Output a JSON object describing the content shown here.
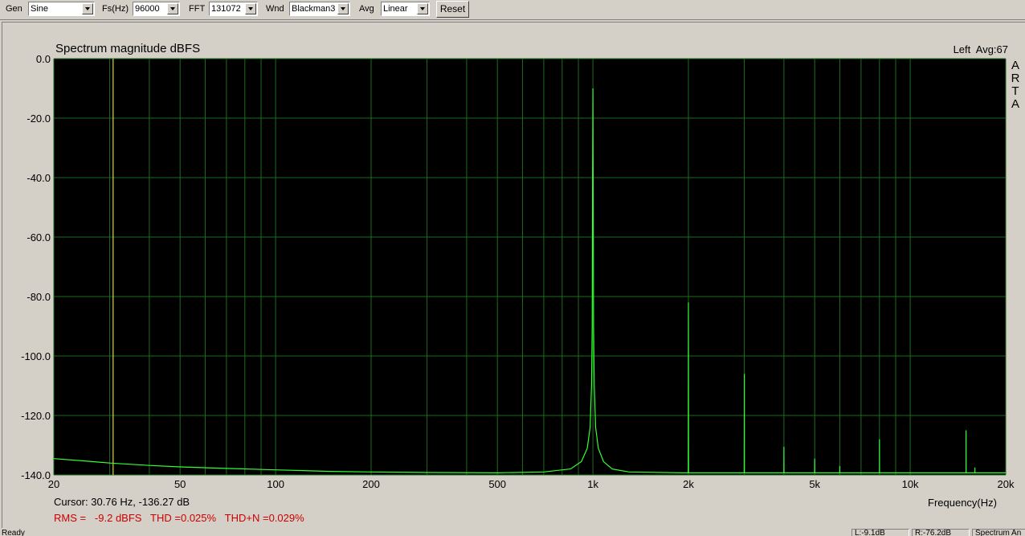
{
  "toolbar": {
    "gen": {
      "label": "Gen",
      "value": "Sine"
    },
    "fs": {
      "label": "Fs(Hz)",
      "value": "96000"
    },
    "fft": {
      "label": "FFT",
      "value": "131072"
    },
    "wnd": {
      "label": "Wnd",
      "value": "Blackman3"
    },
    "avg": {
      "label": "Avg",
      "value": "Linear"
    },
    "reset_label": "Reset"
  },
  "plot": {
    "title": "Spectrum magnitude dBFS",
    "channel_info": "Left  Avg:67",
    "side_logo": [
      "A",
      "R",
      "T",
      "A"
    ],
    "cursor": "Cursor: 30.76 Hz, -136.27 dB",
    "measurements": "RMS =   -9.2 dBFS   THD =0.025%   THD+N =0.029%",
    "x_axis_label": "Frequency(Hz)"
  },
  "chart_data": {
    "type": "line",
    "xscale": "log",
    "xlim": [
      20,
      20000
    ],
    "ylim": [
      -140,
      0
    ],
    "x_tick_labels": [
      {
        "v": 20,
        "t": "20"
      },
      {
        "v": 50,
        "t": "50"
      },
      {
        "v": 100,
        "t": "100"
      },
      {
        "v": 200,
        "t": "200"
      },
      {
        "v": 500,
        "t": "500"
      },
      {
        "v": 1000,
        "t": "1k"
      },
      {
        "v": 2000,
        "t": "2k"
      },
      {
        "v": 5000,
        "t": "5k"
      },
      {
        "v": 10000,
        "t": "10k"
      },
      {
        "v": 20000,
        "t": "20k"
      }
    ],
    "y_tick_labels": [
      {
        "v": 0,
        "t": "0.0"
      },
      {
        "v": -20,
        "t": "-20.0"
      },
      {
        "v": -40,
        "t": "-40.0"
      },
      {
        "v": -60,
        "t": "-60.0"
      },
      {
        "v": -80,
        "t": "-80.0"
      },
      {
        "v": -100,
        "t": "-100.0"
      },
      {
        "v": -120,
        "t": "-120.0"
      },
      {
        "v": -140,
        "t": "-140.0"
      }
    ],
    "grid": true,
    "cursor_x": 30.76,
    "series": [
      {
        "points": [
          [
            20,
            -134.5
          ],
          [
            25,
            -135.3
          ],
          [
            30,
            -136.0
          ],
          [
            40,
            -136.8
          ],
          [
            50,
            -137.3
          ],
          [
            70,
            -137.8
          ],
          [
            100,
            -138.3
          ],
          [
            150,
            -138.8
          ],
          [
            200,
            -139.0
          ],
          [
            300,
            -139.2
          ],
          [
            500,
            -139.3
          ],
          [
            700,
            -139.0
          ],
          [
            850,
            -138.0
          ],
          [
            920,
            -135.5
          ],
          [
            960,
            -131
          ],
          [
            980,
            -124
          ],
          [
            990,
            -110
          ],
          [
            995,
            -90
          ],
          [
            998,
            -40
          ],
          [
            1000,
            -10
          ],
          [
            1002,
            -40
          ],
          [
            1005,
            -90
          ],
          [
            1010,
            -110
          ],
          [
            1020,
            -124
          ],
          [
            1040,
            -131
          ],
          [
            1080,
            -135.5
          ],
          [
            1150,
            -138.0
          ],
          [
            1300,
            -139.0
          ],
          [
            1900,
            -139.3
          ],
          [
            1998,
            -139.3
          ],
          [
            2000,
            -82
          ],
          [
            2002,
            -139.3
          ],
          [
            2998,
            -139.3
          ],
          [
            3000,
            -106
          ],
          [
            3002,
            -139.3
          ],
          [
            3998,
            -139.3
          ],
          [
            4000,
            -130.5
          ],
          [
            4002,
            -139.3
          ],
          [
            4998,
            -139.3
          ],
          [
            5000,
            -134.5
          ],
          [
            5002,
            -139.3
          ],
          [
            5998,
            -139.3
          ],
          [
            6000,
            -137
          ],
          [
            6002,
            -139.3
          ],
          [
            7998,
            -139.3
          ],
          [
            8000,
            -128
          ],
          [
            8002,
            -139.3
          ],
          [
            14998,
            -139.3
          ],
          [
            15000,
            -125
          ],
          [
            15002,
            -139.3
          ],
          [
            15998,
            -139.3
          ],
          [
            16000,
            -137.5
          ],
          [
            16002,
            -139.3
          ],
          [
            20000,
            -139.3
          ]
        ],
        "color": "#33ff33"
      }
    ],
    "colors": {
      "background": "#000000",
      "grid": "#1d6b1d",
      "trace": "#33ff33",
      "cursor": "#ffff66",
      "measurements": "#cc0000"
    }
  },
  "statusbar": {
    "status": "Ready",
    "left_level": "L:-9.1dB",
    "right_level": "R:-76.2dB",
    "mode": "Spectrum An"
  }
}
